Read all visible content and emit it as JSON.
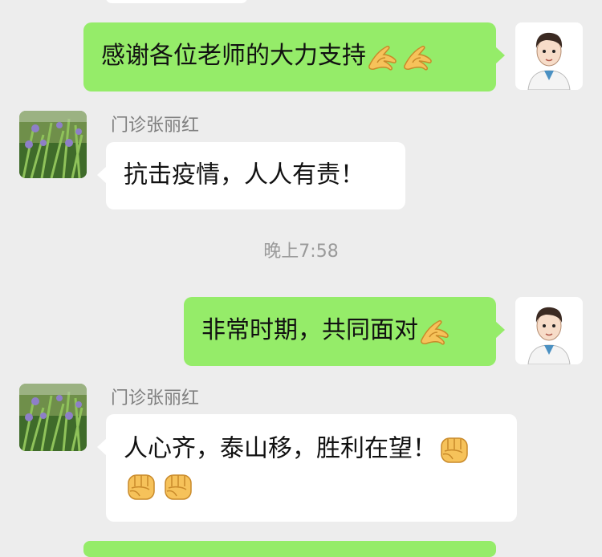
{
  "messages": [
    {
      "side": "me",
      "text": "感谢各位老师的大力支持",
      "emojis": [
        "ok-hand-emoji",
        "ok-hand-emoji"
      ]
    },
    {
      "side": "them",
      "sender": "门诊张丽红",
      "text": "抗击疫情，人人有责！"
    },
    {
      "timestamp": "晚上7:58"
    },
    {
      "side": "me",
      "text": "非常时期，共同面对",
      "emojis": [
        "ok-hand-emoji"
      ]
    },
    {
      "side": "them",
      "sender": "门诊张丽红",
      "text": "人心齐，泰山移，胜利在望！",
      "emojis": [
        "raised-fist-emoji",
        "raised-fist-emoji",
        "raised-fist-emoji"
      ]
    }
  ],
  "colors": {
    "background": "#ededed",
    "my_bubble": "#95ec69",
    "their_bubble": "#ffffff",
    "sender_text": "#7f7f7f"
  }
}
